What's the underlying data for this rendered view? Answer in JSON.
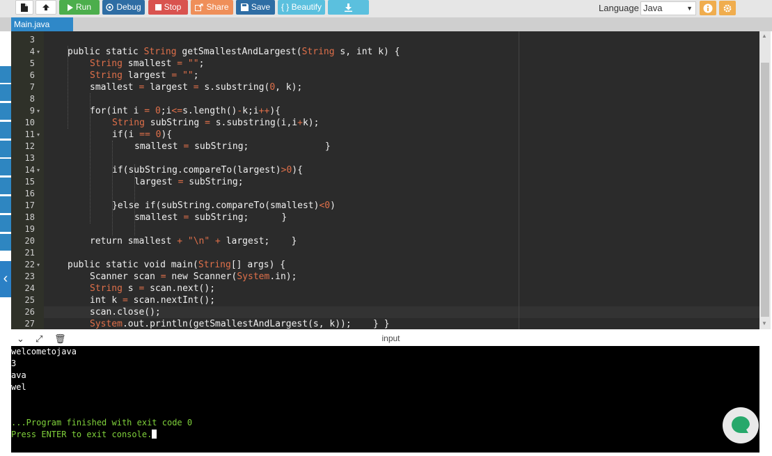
{
  "toolbar": {
    "run_label": "Run",
    "debug_label": "Debug",
    "stop_label": "Stop",
    "share_label": "Share",
    "save_label": "Save",
    "beautify_label": "{ } Beautify",
    "language_label": "Language",
    "language_value": "Java"
  },
  "colors": {
    "run": "#4cae4c",
    "debug": "#2e6da4",
    "stop": "#d9534f",
    "share": "#ef8f59",
    "save": "#2e6da4",
    "beautify": "#5bc0de",
    "download": "#5bc0de",
    "info": "#f0ad4e",
    "settings": "#f0ad4e",
    "tab": "#2f88c8",
    "editor_bg": "#2b2b2b"
  },
  "file_tab": {
    "label": "Main.java"
  },
  "editor": {
    "lines": [
      {
        "num": "3",
        "fold": "",
        "indent": 0,
        "tokens": []
      },
      {
        "num": "4",
        "fold": "▾",
        "indent": 1,
        "tokens": [
          [
            "k",
            "public "
          ],
          [
            "k",
            "static "
          ],
          [
            "t",
            "String "
          ],
          [
            "f",
            "getSmallestAndLargest"
          ],
          [
            "p",
            "("
          ],
          [
            "t",
            "String "
          ],
          [
            "p",
            "s, "
          ],
          [
            "k",
            "int "
          ],
          [
            "p",
            "k) {"
          ]
        ]
      },
      {
        "num": "5",
        "fold": "",
        "indent": 2,
        "tokens": [
          [
            "t",
            "String "
          ],
          [
            "p",
            "smallest "
          ],
          [
            "o",
            "= "
          ],
          [
            "s",
            "\"\""
          ],
          [
            "p",
            ";"
          ]
        ]
      },
      {
        "num": "6",
        "fold": "",
        "indent": 2,
        "tokens": [
          [
            "t",
            "String "
          ],
          [
            "p",
            "largest "
          ],
          [
            "o",
            "= "
          ],
          [
            "s",
            "\"\""
          ],
          [
            "p",
            ";"
          ]
        ]
      },
      {
        "num": "7",
        "fold": "",
        "indent": 2,
        "tokens": [
          [
            "p",
            "smallest "
          ],
          [
            "o",
            "= "
          ],
          [
            "p",
            "largest "
          ],
          [
            "o",
            "= "
          ],
          [
            "p",
            "s.substring("
          ],
          [
            "n",
            "0"
          ],
          [
            "p",
            ", k);"
          ]
        ]
      },
      {
        "num": "8",
        "fold": "",
        "indent": 0,
        "tokens": []
      },
      {
        "num": "9",
        "fold": "▾",
        "indent": 2,
        "tokens": [
          [
            "k",
            "for"
          ],
          [
            "p",
            "("
          ],
          [
            "k",
            "int "
          ],
          [
            "p",
            "i "
          ],
          [
            "o",
            "= "
          ],
          [
            "n",
            "0"
          ],
          [
            "p",
            ";i"
          ],
          [
            "o",
            "<="
          ],
          [
            "p",
            "s.length()"
          ],
          [
            "o",
            "-"
          ],
          [
            "p",
            "k;i"
          ],
          [
            "o",
            "++"
          ],
          [
            "p",
            "){"
          ]
        ]
      },
      {
        "num": "10",
        "fold": "",
        "indent": 3,
        "tokens": [
          [
            "t",
            "String "
          ],
          [
            "p",
            "subString "
          ],
          [
            "o",
            "= "
          ],
          [
            "p",
            "s.substring(i,i"
          ],
          [
            "o",
            "+"
          ],
          [
            "p",
            "k);"
          ]
        ]
      },
      {
        "num": "11",
        "fold": "▾",
        "indent": 3,
        "tokens": [
          [
            "k",
            "if"
          ],
          [
            "p",
            "(i "
          ],
          [
            "o",
            "== "
          ],
          [
            "n",
            "0"
          ],
          [
            "p",
            "){"
          ]
        ]
      },
      {
        "num": "12",
        "fold": "",
        "indent": 4,
        "tokens": [
          [
            "p",
            "smallest "
          ],
          [
            "o",
            "= "
          ],
          [
            "p",
            "subString;              }"
          ]
        ]
      },
      {
        "num": "13",
        "fold": "",
        "indent": 0,
        "tokens": []
      },
      {
        "num": "14",
        "fold": "▾",
        "indent": 3,
        "tokens": [
          [
            "k",
            "if"
          ],
          [
            "p",
            "(subString.compareTo(largest)"
          ],
          [
            "o",
            ">"
          ],
          [
            "n",
            "0"
          ],
          [
            "p",
            "){"
          ]
        ]
      },
      {
        "num": "15",
        "fold": "",
        "indent": 4,
        "tokens": [
          [
            "p",
            "largest "
          ],
          [
            "o",
            "= "
          ],
          [
            "p",
            "subString;"
          ]
        ]
      },
      {
        "num": "16",
        "fold": "",
        "indent": 0,
        "tokens": []
      },
      {
        "num": "17",
        "fold": "",
        "indent": 3,
        "tokens": [
          [
            "p",
            "}"
          ],
          [
            "k",
            "else "
          ],
          [
            "k",
            "if"
          ],
          [
            "p",
            "(subString.compareTo(smallest)"
          ],
          [
            "o",
            "<"
          ],
          [
            "n",
            "0"
          ],
          [
            "p",
            ")"
          ]
        ]
      },
      {
        "num": "18",
        "fold": "",
        "indent": 4,
        "tokens": [
          [
            "p",
            "smallest "
          ],
          [
            "o",
            "= "
          ],
          [
            "p",
            "subString;      }"
          ]
        ]
      },
      {
        "num": "19",
        "fold": "",
        "indent": 0,
        "tokens": []
      },
      {
        "num": "20",
        "fold": "",
        "indent": 2,
        "tokens": [
          [
            "k",
            "return "
          ],
          [
            "p",
            "smallest "
          ],
          [
            "o",
            "+ "
          ],
          [
            "s",
            "\"\\n\" "
          ],
          [
            "o",
            "+ "
          ],
          [
            "p",
            "largest;    }"
          ]
        ]
      },
      {
        "num": "21",
        "fold": "",
        "indent": 0,
        "tokens": []
      },
      {
        "num": "22",
        "fold": "▾",
        "indent": 1,
        "tokens": [
          [
            "k",
            "public "
          ],
          [
            "k",
            "static "
          ],
          [
            "k",
            "void "
          ],
          [
            "f",
            "main"
          ],
          [
            "p",
            "("
          ],
          [
            "t",
            "String"
          ],
          [
            "p",
            "[] args) {"
          ]
        ]
      },
      {
        "num": "23",
        "fold": "",
        "indent": 2,
        "tokens": [
          [
            "p",
            "Scanner scan "
          ],
          [
            "o",
            "= "
          ],
          [
            "k",
            "new "
          ],
          [
            "p",
            "Scanner("
          ],
          [
            "t",
            "System"
          ],
          [
            "p",
            ".in);"
          ]
        ]
      },
      {
        "num": "24",
        "fold": "",
        "indent": 2,
        "tokens": [
          [
            "t",
            "String "
          ],
          [
            "p",
            "s "
          ],
          [
            "o",
            "= "
          ],
          [
            "p",
            "scan.next();"
          ]
        ]
      },
      {
        "num": "25",
        "fold": "",
        "indent": 2,
        "tokens": [
          [
            "k",
            "int "
          ],
          [
            "p",
            "k "
          ],
          [
            "o",
            "= "
          ],
          [
            "p",
            "scan.nextInt();"
          ]
        ]
      },
      {
        "num": "26",
        "fold": "",
        "indent": 2,
        "tokens": [
          [
            "p",
            "scan.close();"
          ]
        ]
      },
      {
        "num": "27",
        "fold": "",
        "indent": 2,
        "tokens": [
          [
            "t",
            "System"
          ],
          [
            "p",
            ".out.println(getSmallestAndLargest(s, k));    } }"
          ]
        ]
      }
    ]
  },
  "console": {
    "title": "input",
    "lines": [
      {
        "text": "welcometojava",
        "green": false
      },
      {
        "text": "3",
        "green": false
      },
      {
        "text": "ava",
        "green": false
      },
      {
        "text": "wel",
        "green": false
      },
      {
        "text": "",
        "green": false
      },
      {
        "text": "",
        "green": false
      },
      {
        "text": "...Program finished with exit code 0",
        "green": true
      },
      {
        "text": "Press ENTER to exit console.",
        "green": true,
        "cursor": true
      }
    ]
  }
}
